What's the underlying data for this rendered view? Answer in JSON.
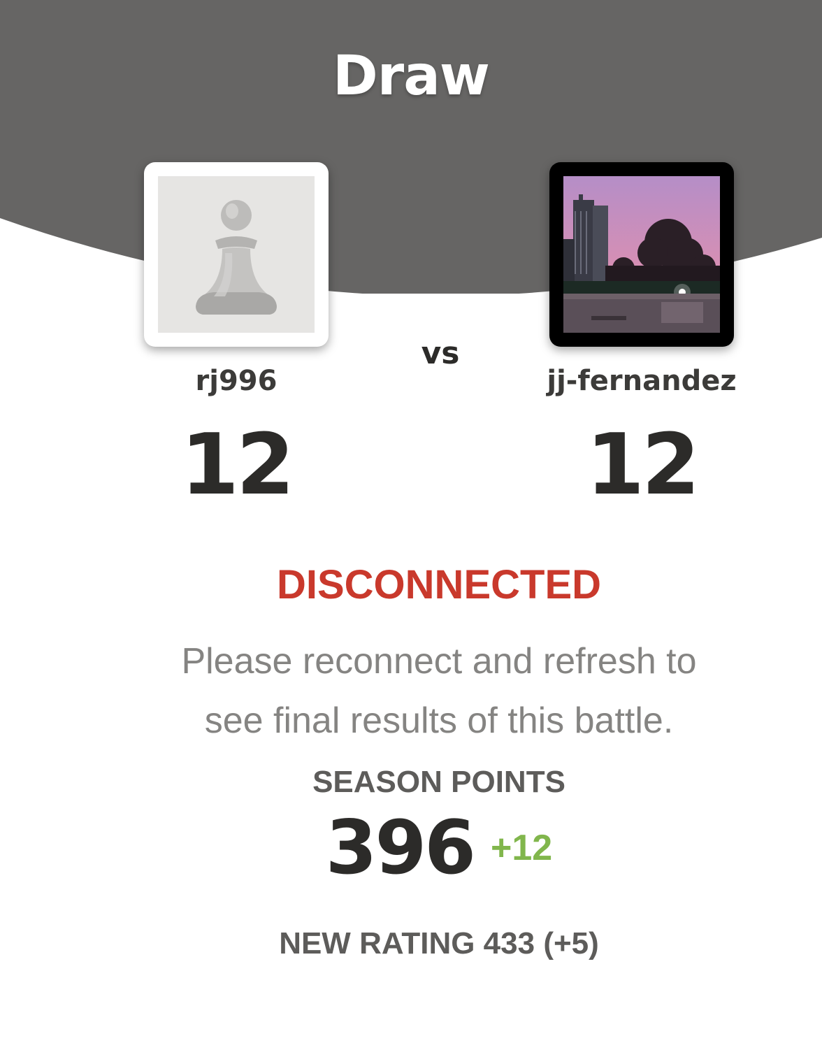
{
  "header": {
    "result": "Draw",
    "background_color": "#666564"
  },
  "players": {
    "left": {
      "username": "rj996",
      "score": "12",
      "avatar": "pawn-icon"
    },
    "vs_label": "vs",
    "right": {
      "username": "jj-fernandez",
      "score": "12",
      "avatar": "city-photo-avatar"
    }
  },
  "status": {
    "label": "DISCONNECTED",
    "message_line1": "Please reconnect and refresh to",
    "message_line2": "see final results of this battle.",
    "color": "#c9392c"
  },
  "season": {
    "label": "SEASON POINTS",
    "value": "396",
    "delta": "+12",
    "delta_color": "#81b64c"
  },
  "rating": {
    "text": "NEW RATING 433 (+5)"
  }
}
